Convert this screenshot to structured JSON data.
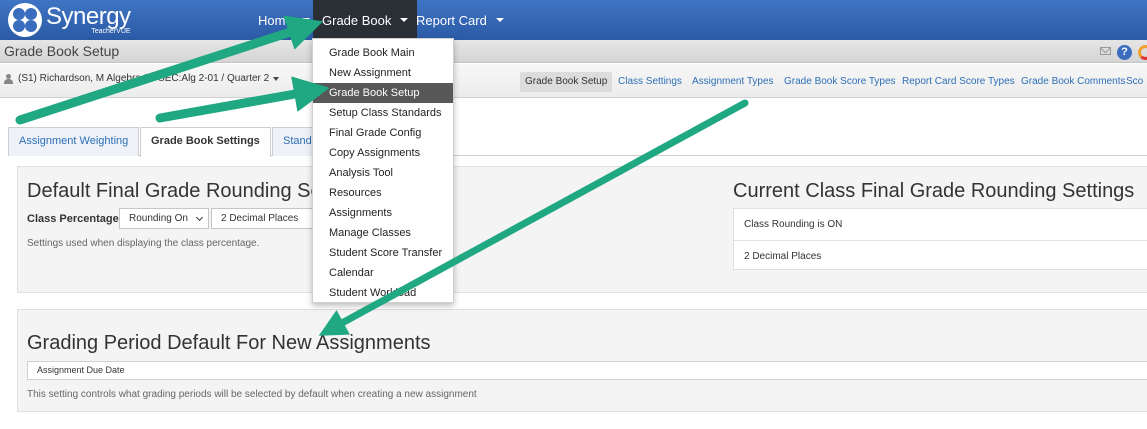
{
  "app": {
    "logo_title": "Synergy",
    "logo_subtitle": "TeacherVUE",
    "brand_color": "#3a6dbd",
    "highlight_arrow_color": "#1fa882"
  },
  "nav": {
    "items": [
      {
        "label": "Home"
      },
      {
        "label": "Grade Book"
      },
      {
        "label": "Report Card"
      }
    ]
  },
  "gradebook_menu": {
    "items": [
      "Grade Book Main",
      "New Assignment",
      "Grade Book Setup",
      "Setup Class Standards",
      "Final Grade Config",
      "Copy Assignments",
      "Analysis Tool",
      "Resources",
      "Assignments",
      "Manage Classes",
      "Student Score Transfer",
      "Calendar",
      "Student Workload"
    ],
    "selected": "Grade Book Setup"
  },
  "titlebar": {
    "title": "Grade Book Setup",
    "help_glyph": "?"
  },
  "toolbar": {
    "class_selector": "(S1) Richardson, M Algebra 2 · SEC:Alg 2-01 / Quarter 2",
    "subtabs": [
      "Grade Book Setup",
      "Class Settings",
      "Assignment Types",
      "Grade Book Score Types",
      "Report Card Score Types",
      "Grade Book Comments",
      "Sco"
    ]
  },
  "inner_tabs": [
    {
      "label": "Assignment Weighting"
    },
    {
      "label": "Grade Book Settings"
    },
    {
      "label": "Stand"
    }
  ],
  "rounding_panel": {
    "heading": "Default Final Grade Rounding Setti",
    "class_pct_label": "Class Percentage",
    "rounding_select": "Rounding On",
    "decimal_select": "2 Decimal Places",
    "help": "Settings used when displaying the class percentage."
  },
  "current_panel": {
    "heading": "Current Class Final Grade Rounding Settings",
    "rows": [
      "Class Rounding is ON",
      "2 Decimal Places"
    ]
  },
  "period_panel": {
    "heading": "Grading Period Default For New Assignments",
    "field_value": "Assignment Due Date",
    "help": "This setting controls what grading periods will be selected by default when creating a new assignment"
  }
}
